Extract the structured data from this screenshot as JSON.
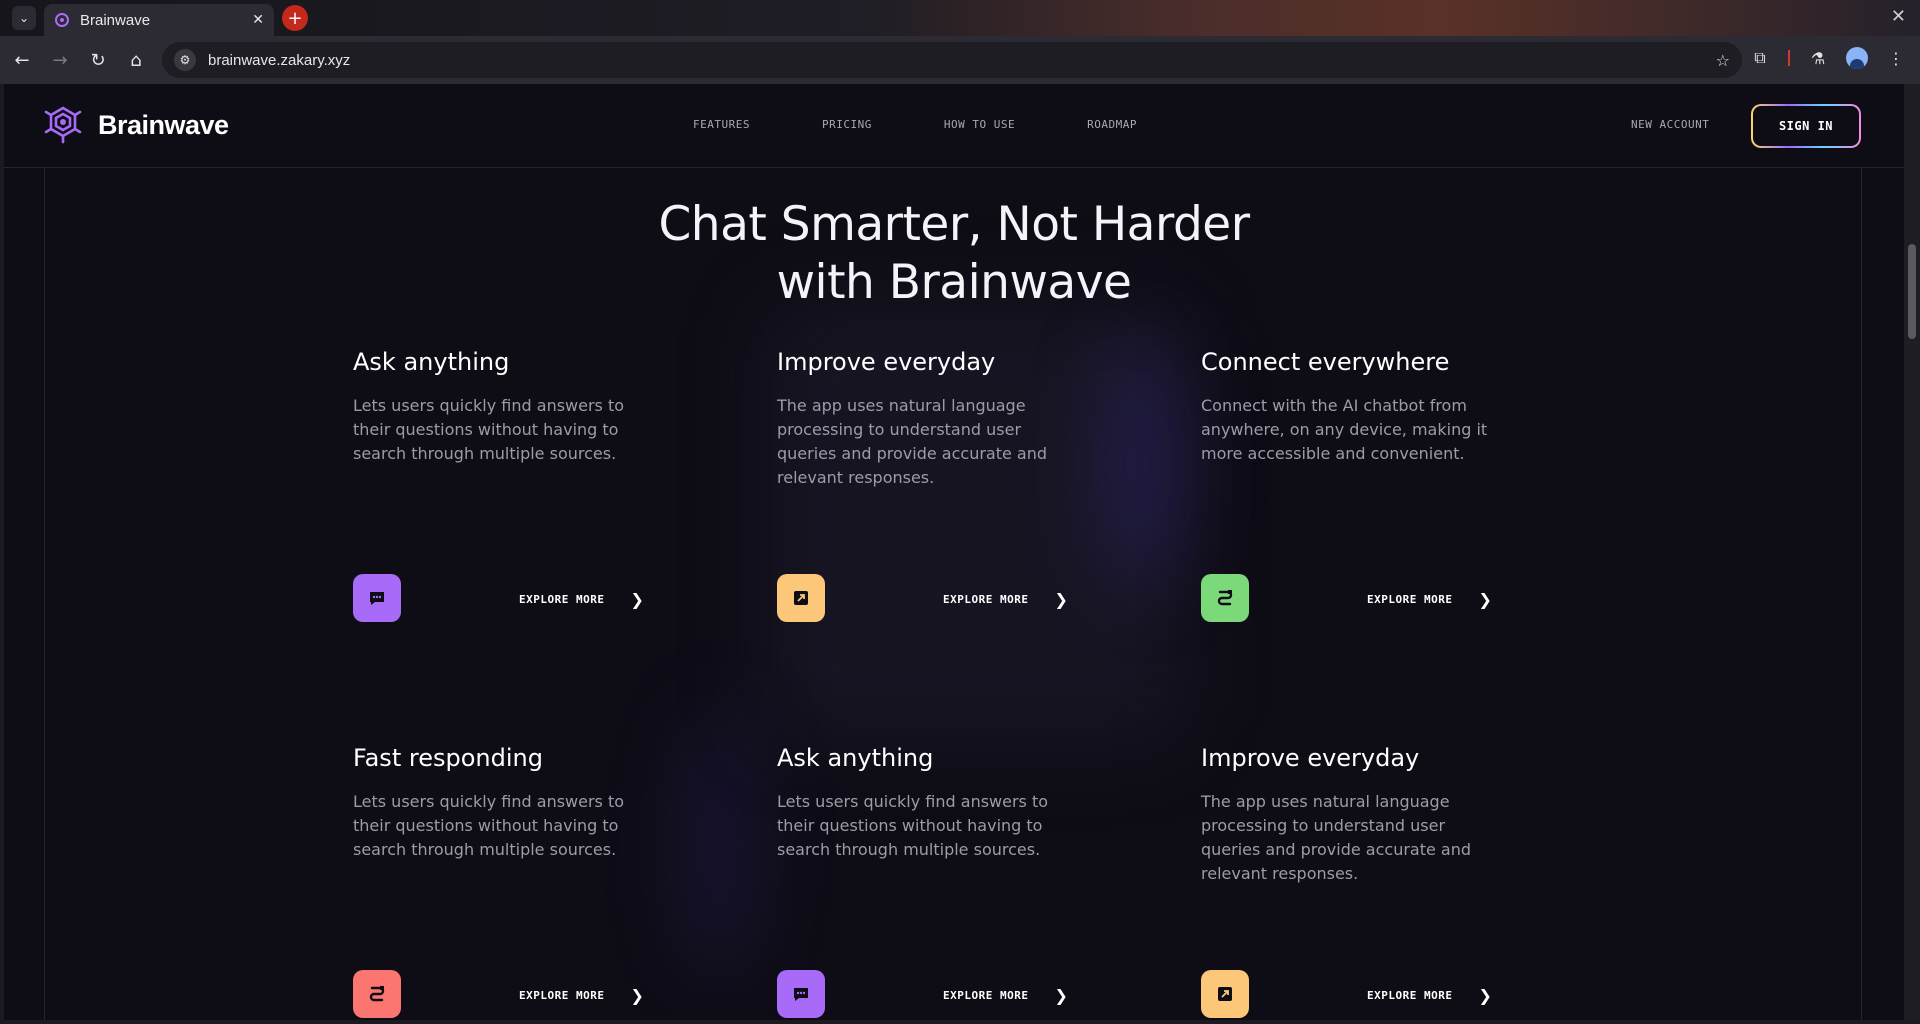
{
  "browser": {
    "tab_title": "Brainwave",
    "url": "brainwave.zakary.xyz"
  },
  "header": {
    "brand": "Brainwave",
    "nav": [
      "FEATURES",
      "PRICING",
      "HOW TO USE",
      "ROADMAP"
    ],
    "new_account": "NEW ACCOUNT",
    "sign_in": "SIGN IN"
  },
  "hero": {
    "line1": "Chat Smarter, Not Harder",
    "line2": "with Brainwave"
  },
  "cards": [
    {
      "title": "Ask anything",
      "text": "Lets users quickly find answers to their questions without having to search through multiple sources.",
      "icon": "chat-icon",
      "color": "#a86bf7",
      "cta": "EXPLORE MORE"
    },
    {
      "title": "Improve everyday",
      "text": "The app uses natural language processing to understand user queries and provide accurate and relevant responses.",
      "icon": "expand-icon",
      "color": "#fdc77a",
      "cta": "EXPLORE MORE"
    },
    {
      "title": "Connect everywhere",
      "text": "Connect with the AI chatbot from anywhere, on any device, making it more accessible and convenient.",
      "icon": "plug-icon",
      "color": "#7bd97a",
      "cta": "EXPLORE MORE"
    },
    {
      "title": "Fast responding",
      "text": "Lets users quickly find answers to their questions without having to search through multiple sources.",
      "icon": "plug-icon",
      "color": "#fb7670",
      "cta": "EXPLORE MORE"
    },
    {
      "title": "Ask anything",
      "text": "Lets users quickly find answers to their questions without having to search through multiple sources.",
      "icon": "chat-icon",
      "color": "#a86bf7",
      "cta": "EXPLORE MORE"
    },
    {
      "title": "Improve everyday",
      "text": "The app uses natural language processing to understand user queries and provide accurate and relevant responses.",
      "icon": "expand-icon",
      "color": "#fdc77a",
      "cta": "EXPLORE MORE"
    }
  ]
}
